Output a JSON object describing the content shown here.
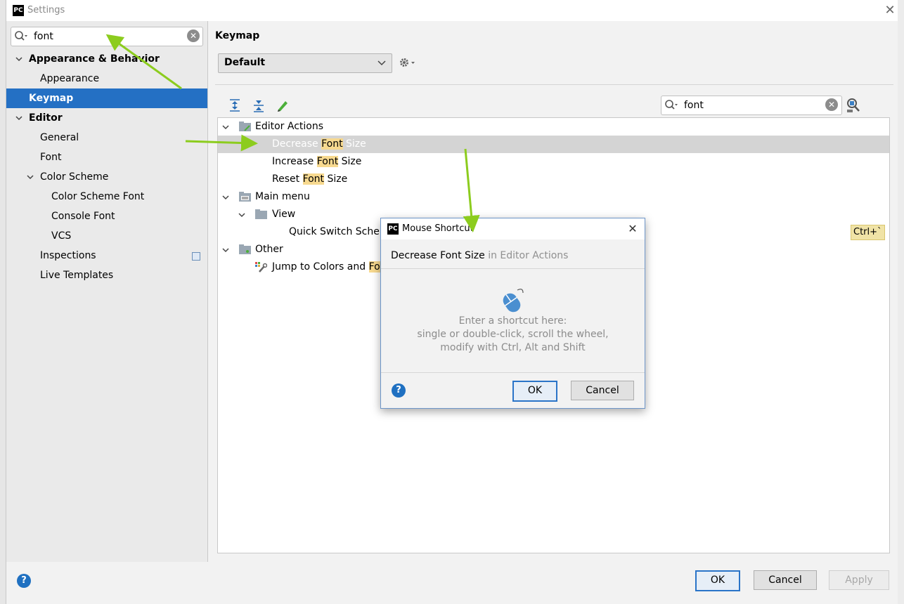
{
  "window": {
    "title": "Settings",
    "logo_text": "PC"
  },
  "sidebar": {
    "search": {
      "value": "font",
      "placeholder": ""
    },
    "items": [
      {
        "label": "Appearance & Behavior",
        "level": 0,
        "bold": true,
        "expanded": true
      },
      {
        "label": "Appearance",
        "level": 1
      },
      {
        "label": "Keymap",
        "level": 0,
        "bold": true,
        "selected": true
      },
      {
        "label": "Editor",
        "level": 0,
        "bold": true,
        "expanded": true
      },
      {
        "label": "General",
        "level": 1
      },
      {
        "label": "Font",
        "level": 1
      },
      {
        "label": "Color Scheme",
        "level": 1,
        "expanded": true
      },
      {
        "label": "Color Scheme Font",
        "level": 2
      },
      {
        "label": "Console Font",
        "level": 2
      },
      {
        "label": "VCS",
        "level": 2
      },
      {
        "label": "Inspections",
        "level": 1,
        "has_copy_icon": true
      },
      {
        "label": "Live Templates",
        "level": 1
      }
    ]
  },
  "keymap": {
    "title": "Keymap",
    "scheme": "Default",
    "search": {
      "value": "font"
    },
    "toolbar": [
      "expand-all-icon",
      "collapse-all-icon",
      "edit-icon"
    ],
    "tree": {
      "editor_actions": "Editor Actions",
      "decrease": {
        "pre": "Decrease ",
        "hl": "Font",
        "post": " Size"
      },
      "increase": {
        "pre": "Increase ",
        "hl": "Font",
        "post": " Size"
      },
      "reset": {
        "pre": "Reset ",
        "hl": "Font",
        "post": " Size"
      },
      "main_menu": "Main menu",
      "view": "View",
      "quick_switch": "Quick Switch Schem",
      "other": "Other",
      "jump": {
        "pre": "Jump to Colors and ",
        "hl": "For"
      },
      "shortcut_badge": "Ctrl+`"
    }
  },
  "dialog": {
    "title": "Mouse Shortcut",
    "action_name": "Decrease Font Size",
    "action_context": " in Editor Actions",
    "hint_lines": [
      "Enter a shortcut here:",
      "single or double-click, scroll the wheel,",
      "modify with Ctrl, Alt and Shift"
    ],
    "ok_label": "OK",
    "cancel_label": "Cancel",
    "help": "?"
  },
  "footer": {
    "ok_label": "OK",
    "cancel_label": "Cancel",
    "apply_label": "Apply",
    "help": "?"
  },
  "colors": {
    "selection": "#2470c4",
    "highlight": "#f7d98f",
    "annotation_arrow": "#8ccc1e",
    "help_blue": "#1f70c1"
  }
}
